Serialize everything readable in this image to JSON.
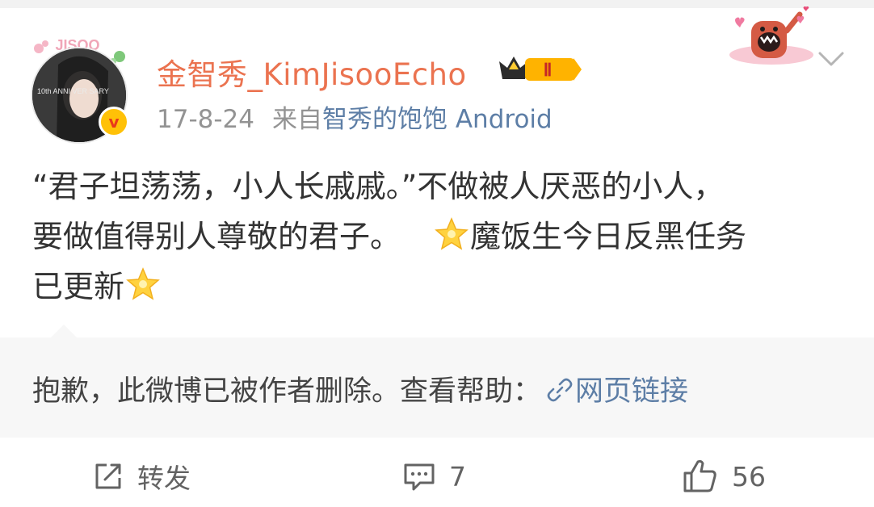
{
  "post": {
    "username": "金智秀_KimJisooEcho",
    "vip_level": "Ⅱ",
    "timestamp": "17-8-24",
    "source_prefix": "来自",
    "source_name": "智秀的饱饱 Android",
    "avatar_caption": "JISOO",
    "avatar_inner_text": "10th ANNI VER SARY",
    "text_line1": "“君子坦荡荡，小人长戚戚。”不做被人厌恶的小人，",
    "text_line2a": "要做值得别人尊敬的君子。",
    "text_line2b": "魔饭生今日反黑任务",
    "text_line3": "已更新"
  },
  "retweet": {
    "deleted_notice": "抱歉，此微博已被作者删除。查看帮助：",
    "link_label": "网页链接"
  },
  "actions": {
    "repost_label": "转发",
    "comment_count": "7",
    "like_count": "56"
  },
  "colors": {
    "username": "#eb7350",
    "link": "#5d7ea6",
    "meta": "#939393",
    "text": "#333333",
    "retweet_bg": "#f7f7f7"
  },
  "icons": [
    "verified-badge-icon",
    "vip-crown-icon",
    "sticker-icon",
    "chevron-down-icon",
    "star-emoji-icon",
    "link-icon",
    "repost-icon",
    "comment-icon",
    "like-icon"
  ]
}
